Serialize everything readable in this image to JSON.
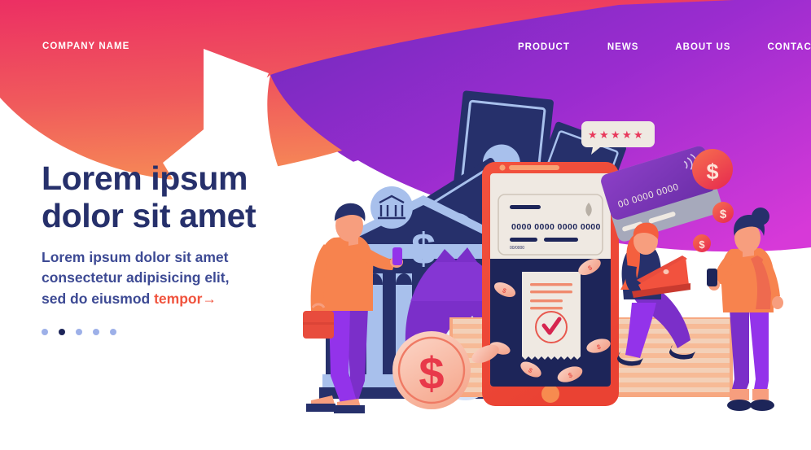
{
  "brand": {
    "name": "COMPANY NAME"
  },
  "nav": {
    "items": [
      {
        "label": "PRODUCT"
      },
      {
        "label": "NEWS"
      },
      {
        "label": "ABOUT US"
      },
      {
        "label": "CONTACTS"
      }
    ]
  },
  "hero": {
    "headline_line1": "Lorem ipsum",
    "headline_line2": "dolor sit amet",
    "sub_line1": "Lorem ipsum dolor sit amet",
    "sub_line2": "consectetur adipisicing elit,",
    "sub_line3_plain": "sed do eiusmod",
    "sub_line3_accent": "tempor",
    "sub_arrow": "→"
  },
  "carousel": {
    "dots": [
      {
        "active": false
      },
      {
        "active": true
      },
      {
        "active": false
      },
      {
        "active": false
      },
      {
        "active": false
      }
    ]
  },
  "illustration": {
    "phone_card_number": "0000 0000 0000 0000",
    "phone_card_expiry": "00/0000",
    "credit_card_number": "00 0000 0000",
    "coin_symbol": "$",
    "bank_dollar_symbol": "$",
    "rating_stars": 5,
    "star_glyph": "★",
    "receipt_check": "check-mark"
  },
  "colors": {
    "header_gradient_start": "#ee3a63",
    "header_gradient_end": "#f4815a",
    "purple_blob_start": "#7a2ec0",
    "purple_blob_end": "#d434d6",
    "navy": "#26306b",
    "deep_navy": "#1d2559",
    "accent_red": "#f0533d",
    "coral": "#f4553f",
    "orange": "#f78b5a",
    "purple": "#7b2fc9",
    "violet": "#8f2fd4",
    "light_blue": "#a8c0ec",
    "pale_blue": "#cfdcf6",
    "lavender_blob": "#d6dbf7",
    "cream": "#efe9e2",
    "skin": "#f79e7e",
    "hair_red": "#f4603f",
    "dot_inactive": "#9db0e8"
  }
}
